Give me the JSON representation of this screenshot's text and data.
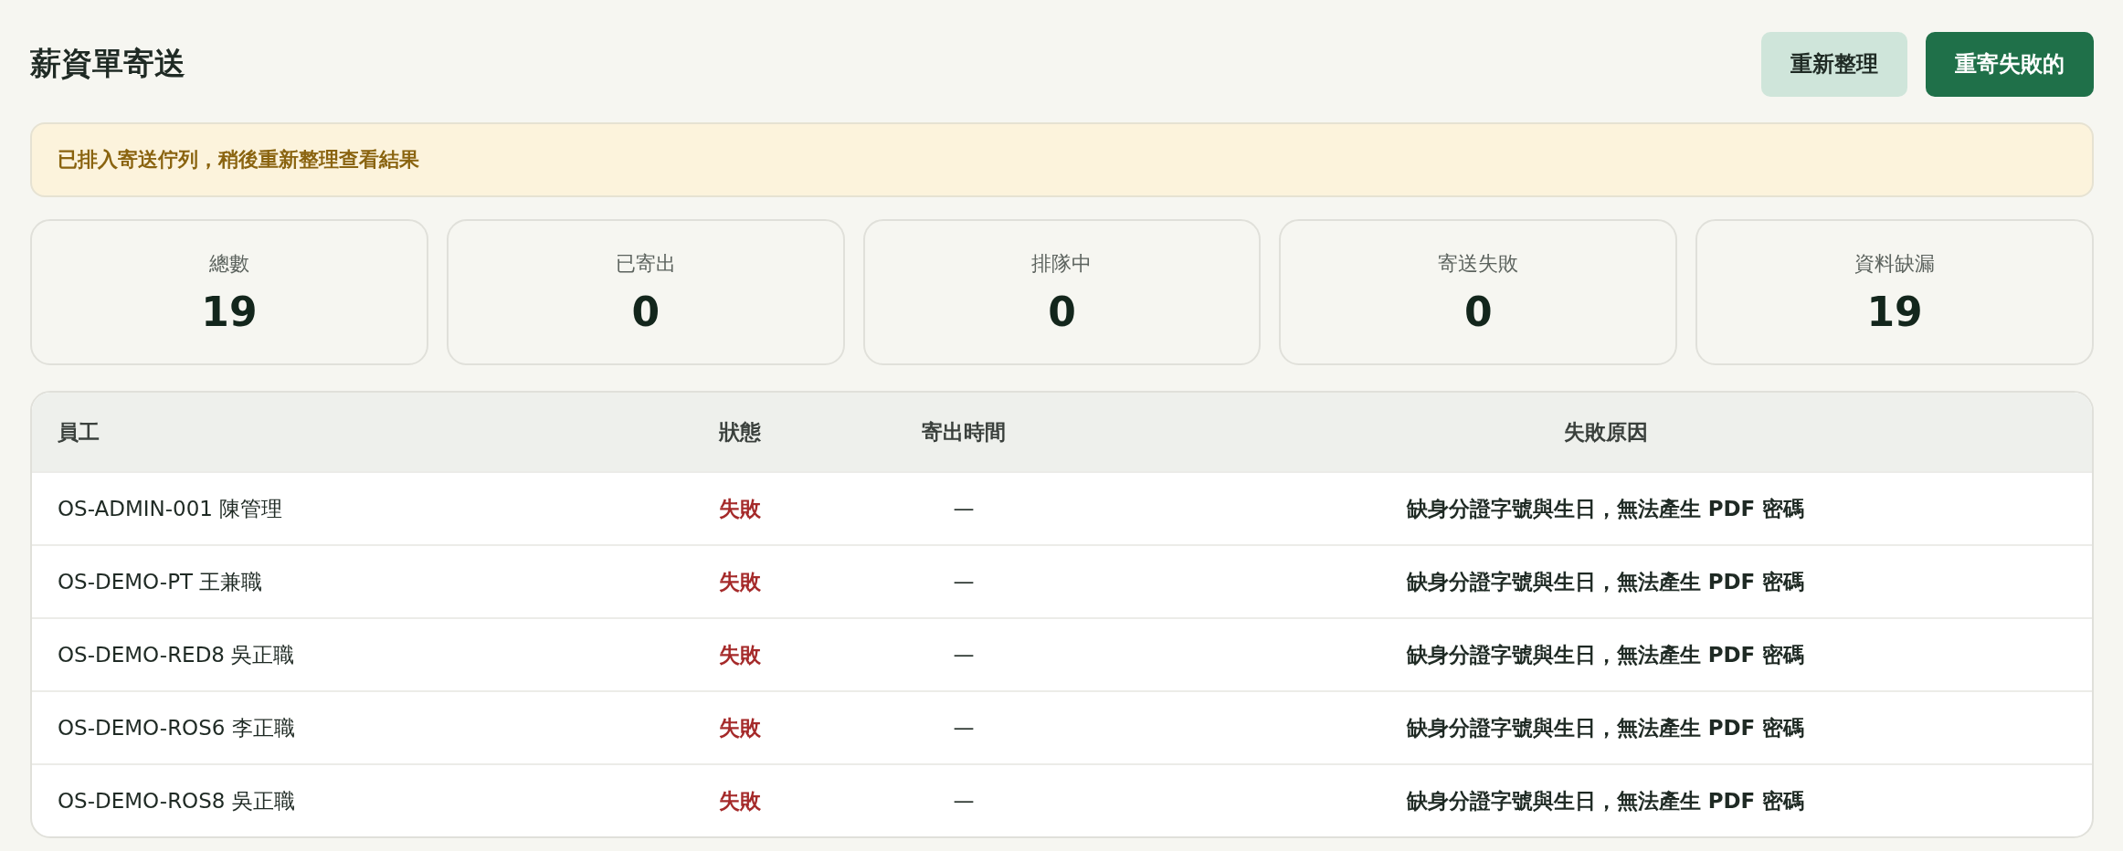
{
  "page": {
    "title": "薪資單寄送"
  },
  "actions": [
    {
      "label": "重新整理",
      "kind": "secondary"
    },
    {
      "label": "重寄失敗的",
      "kind": "primary"
    }
  ],
  "notice": {
    "text": "已排入寄送佇列，稍後重新整理查看結果"
  },
  "stats": [
    {
      "label": "總數",
      "value": "19"
    },
    {
      "label": "已寄出",
      "value": "0"
    },
    {
      "label": "排隊中",
      "value": "0"
    },
    {
      "label": "寄送失敗",
      "value": "0"
    },
    {
      "label": "資料缺漏",
      "value": "19"
    }
  ],
  "table": {
    "columns": [
      "員工",
      "狀態",
      "寄出時間",
      "失敗原因"
    ],
    "rows": [
      {
        "employee": "OS-ADMIN-001 陳管理",
        "status": "失敗",
        "kind": "failed",
        "sent_at": "—",
        "reason": "缺身分證字號與生日，無法產生 PDF 密碼"
      },
      {
        "employee": "OS-DEMO-PT 王兼職",
        "status": "失敗",
        "kind": "failed",
        "sent_at": "—",
        "reason": "缺身分證字號與生日，無法產生 PDF 密碼"
      },
      {
        "employee": "OS-DEMO-RED8 吳正職",
        "status": "失敗",
        "kind": "failed",
        "sent_at": "—",
        "reason": "缺身分證字號與生日，無法產生 PDF 密碼"
      },
      {
        "employee": "OS-DEMO-ROS6 李正職",
        "status": "失敗",
        "kind": "failed",
        "sent_at": "—",
        "reason": "缺身分證字號與生日，無法產生 PDF 密碼"
      },
      {
        "employee": "OS-DEMO-ROS8 吳正職",
        "status": "失敗",
        "kind": "failed",
        "sent_at": "—",
        "reason": "缺身分證字號與生日，無法產生 PDF 密碼"
      }
    ]
  }
}
